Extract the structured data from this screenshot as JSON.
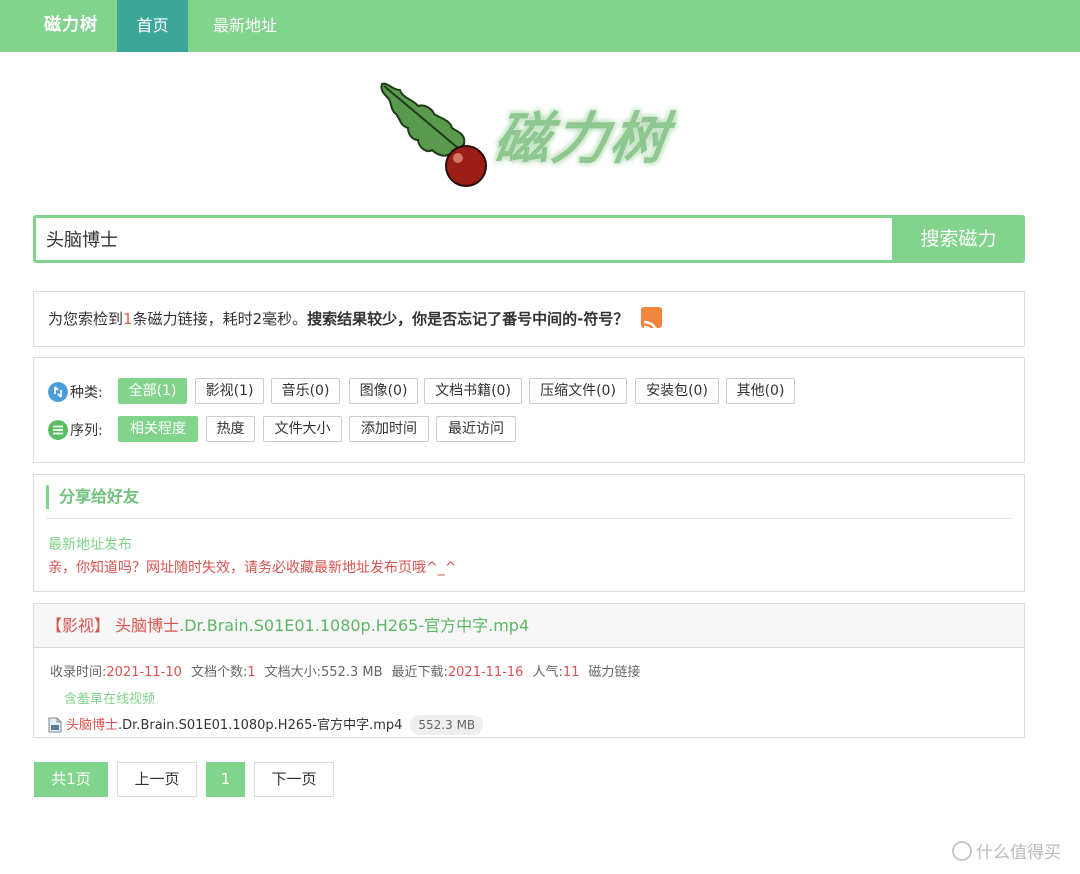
{
  "nav": {
    "brand": "磁力树",
    "tabs": [
      {
        "label": "首页",
        "active": true
      },
      {
        "label": "最新地址",
        "active": false
      }
    ]
  },
  "logo": {
    "text": "磁力树"
  },
  "search": {
    "value": "头脑博士",
    "button": "搜索磁力"
  },
  "info": {
    "prefix": "为您索检到",
    "count": "1",
    "suffix": "条磁力链接，耗时2毫秒。",
    "tip": "搜索结果较少，你是否忘记了番号中间的-符号？"
  },
  "filters": {
    "type_label": "种类:",
    "types": [
      "全部(1)",
      "影视(1)",
      "音乐(0)",
      "图像(0)",
      "文档书籍(0)",
      "压缩文件(0)",
      "安装包(0)",
      "其他(0)"
    ],
    "sort_label": "序列:",
    "sorts": [
      "相关程度",
      "热度",
      "文件大小",
      "添加时间",
      "最近访问"
    ]
  },
  "share": {
    "title": "分享给好友",
    "link": "最新地址发布",
    "note": "亲，你知道吗？网址随时失效，请务必收藏最新地址发布页哦^_^"
  },
  "result": {
    "category": "【影视】",
    "keyword": "头脑博士",
    "title_rest": ".Dr.Brain.S01E01.1080p.H265-官方中字.mp4",
    "meta": {
      "added_label": "收录时间:",
      "added": "2021-11-10",
      "count_label": "文档个数:",
      "count": "1",
      "size_label": "文档大小:",
      "size": "552.3 MB",
      "last_label": "最近下载:",
      "last": "2021-11-16",
      "pop_label": "人气:",
      "pop": "11",
      "magnet": "磁力链接"
    },
    "online": "含羞草在线视频",
    "file": {
      "keyword": "头脑博士",
      "name_rest": ".Dr.Brain.S01E01.1080p.H265-官方中字.mp4",
      "size": "552.3 MB"
    }
  },
  "pagination": {
    "total": "共1页",
    "prev": "上一页",
    "current": "1",
    "next": "下一页"
  },
  "watermark": "什么值得买",
  "colors": {
    "accent": "#82d48c",
    "active_tab": "#3ea79c",
    "highlight": "#d9534f",
    "rss": "#f0863e"
  }
}
